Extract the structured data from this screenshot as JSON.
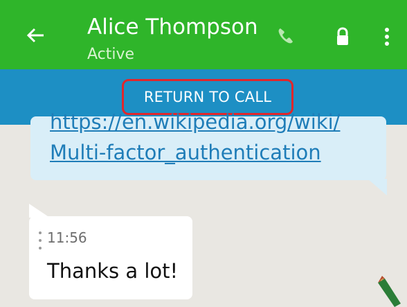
{
  "header": {
    "contact_name": "Alice Thompson",
    "status": "Active",
    "background": "#2fb52a"
  },
  "call_banner": {
    "label": "RETURN TO CALL",
    "background": "#1d8fc4",
    "highlight_border": "#e1262b"
  },
  "messages": [
    {
      "direction": "outgoing",
      "link_lines": [
        "https://en.wikipedia.org/wiki/",
        "Multi-factor_authentication"
      ]
    },
    {
      "direction": "incoming",
      "time": "11:56",
      "text": "Thanks a lot!"
    }
  ],
  "icons": {
    "back": "arrow-left-icon",
    "call": "phone-icon",
    "lock": "lock-icon",
    "more": "more-vertical-icon",
    "pencil": "pencil-icon"
  }
}
